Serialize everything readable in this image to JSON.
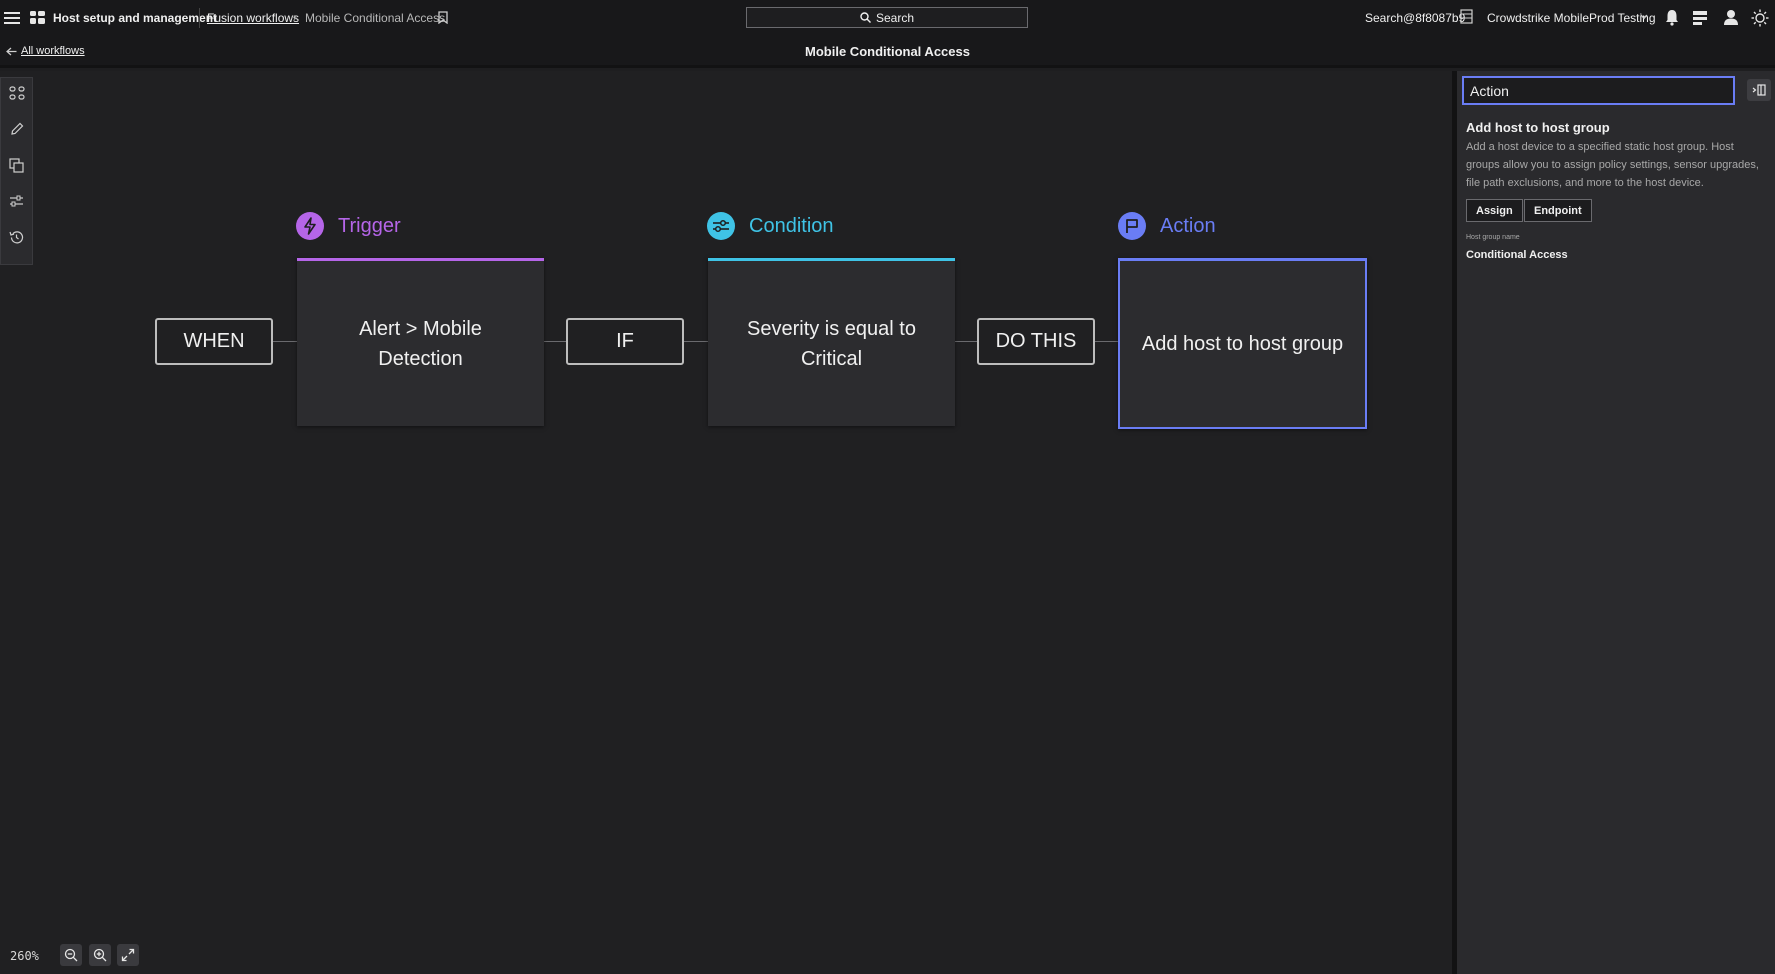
{
  "header": {
    "app_title": "Host setup and management",
    "breadcrumb_link": "Fusion workflows",
    "breadcrumb_sep": "›",
    "breadcrumb_current": "Mobile Conditional Access",
    "search_label": "Search",
    "user_id": "Search@8f8087b9",
    "tenant": "Crowdstrike MobileProd Testing"
  },
  "subheader": {
    "back_label": "All workflows",
    "page_title": "Mobile Conditional Access"
  },
  "workflow": {
    "trigger": {
      "label": "Trigger",
      "connector": "WHEN",
      "card": "Alert > Mobile Detection",
      "color": "#b565e8"
    },
    "condition": {
      "label": "Condition",
      "connector": "IF",
      "card": "Severity is equal to Critical",
      "color": "#3fc3e6"
    },
    "action": {
      "label": "Action",
      "connector": "DO THIS",
      "card": "Add host to host group",
      "color": "#6a7df5"
    }
  },
  "zoom": {
    "level": "260%"
  },
  "panel": {
    "input_value": "Action",
    "heading": "Add host to host group",
    "description": "Add a host device to a specified static host group. Host groups allow you to assign policy settings, sensor upgrades, file path exclusions, and more to the host device.",
    "tags": [
      "Assign",
      "Endpoint"
    ],
    "field_label": "Host group name",
    "field_value": "Conditional Access"
  }
}
